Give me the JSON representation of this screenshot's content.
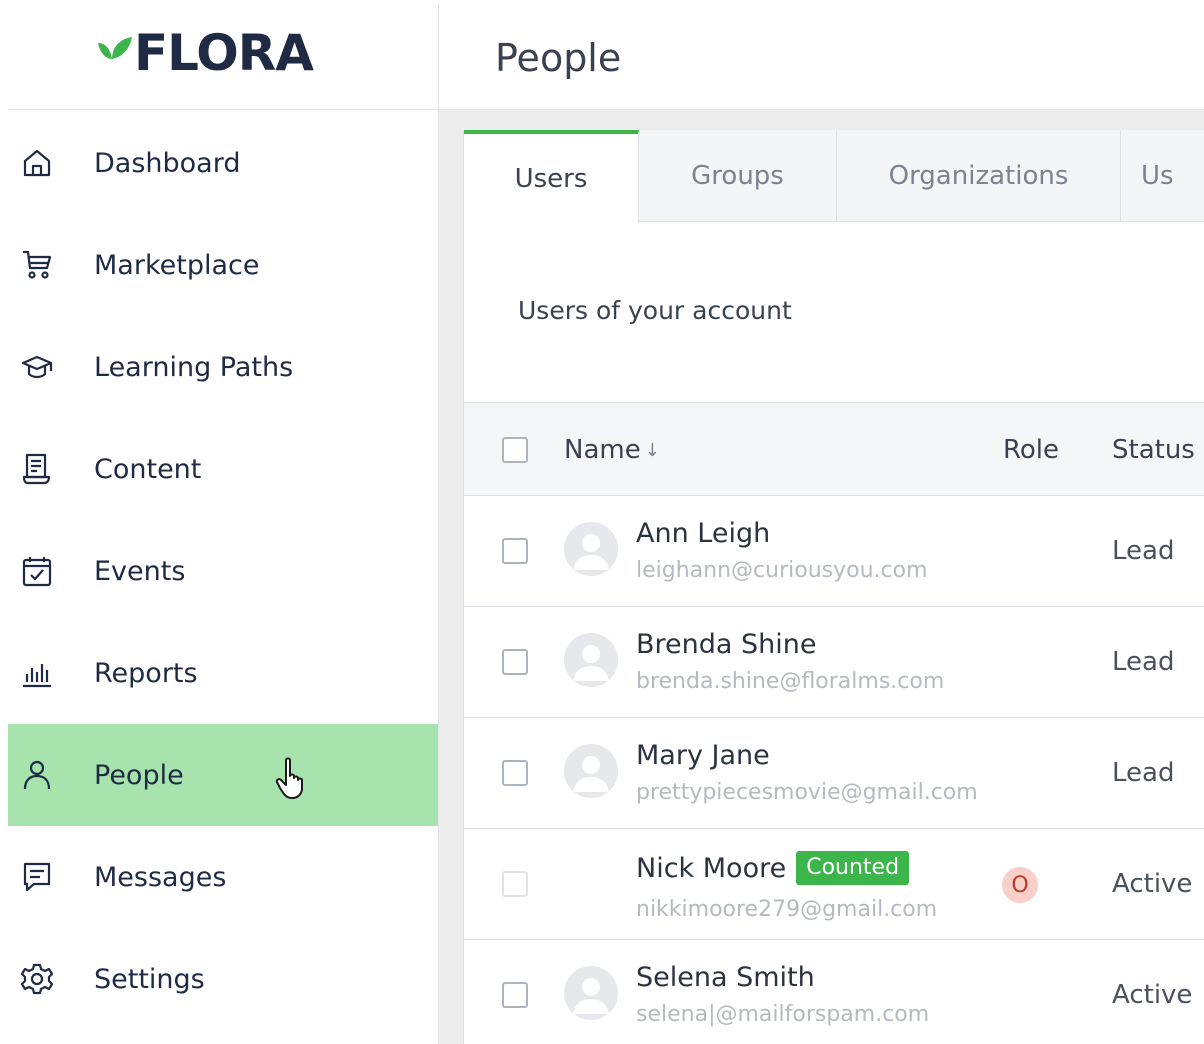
{
  "app": {
    "logo_text": "FLORA",
    "brand_color": "#3cb54a"
  },
  "sidebar": {
    "items": [
      {
        "label": "Dashboard",
        "icon": "home-icon"
      },
      {
        "label": "Marketplace",
        "icon": "cart-icon"
      },
      {
        "label": "Learning Paths",
        "icon": "graduation-cap-icon"
      },
      {
        "label": "Content",
        "icon": "document-icon"
      },
      {
        "label": "Events",
        "icon": "calendar-check-icon"
      },
      {
        "label": "Reports",
        "icon": "bar-chart-icon"
      },
      {
        "label": "People",
        "icon": "person-icon",
        "active": true
      },
      {
        "label": "Messages",
        "icon": "message-icon"
      },
      {
        "label": "Settings",
        "icon": "gear-icon"
      }
    ],
    "active_color": "#a6e3ad"
  },
  "header": {
    "title": "People"
  },
  "tabs": [
    {
      "label": "Users",
      "active": true
    },
    {
      "label": "Groups"
    },
    {
      "label": "Organizations"
    },
    {
      "label": "Us"
    }
  ],
  "section": {
    "subtitle": "Users of your account"
  },
  "table": {
    "columns": {
      "name": "Name",
      "role": "Role",
      "status": "Status"
    },
    "sort_indicator": "↓",
    "rows": [
      {
        "name": "Ann Leigh",
        "email": "leighann@curiousyou.com",
        "status": "Lead",
        "badge": "",
        "role": ""
      },
      {
        "name": "Brenda Shine",
        "email": "brenda.shine@floralms.com",
        "status": "Lead",
        "badge": "",
        "role": ""
      },
      {
        "name": "Mary Jane",
        "email": "prettypiecesmovie@gmail.com",
        "status": "Lead",
        "badge": "",
        "role": ""
      },
      {
        "name": "Nick Moore",
        "email": "nikkimoore279@gmail.com",
        "status": "Active",
        "badge": "Counted",
        "role": "O"
      },
      {
        "name": "Selena Smith",
        "email": "selena|@mailforspam.com",
        "status": "Active",
        "badge": "",
        "role": ""
      }
    ]
  }
}
